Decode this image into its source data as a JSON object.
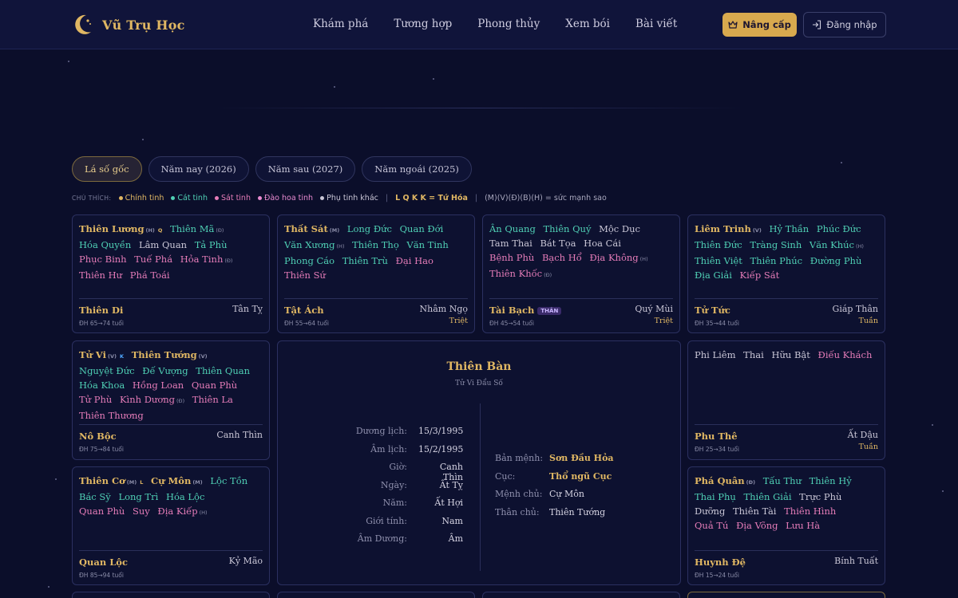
{
  "header": {
    "brand": "Vũ Trụ Học",
    "nav": [
      "Khám phá",
      "Tương hợp",
      "Phong thủy",
      "Xem bói",
      "Bài viết"
    ],
    "upgrade_label": "Nâng cấp",
    "login_label": "Đăng nhập"
  },
  "tabs": [
    "Lá số gốc",
    "Năm nay (2026)",
    "Năm sau (2027)",
    "Năm ngoái (2025)"
  ],
  "legend": {
    "label": "CHÚ THÍCH:",
    "items": [
      {
        "text": "Chính tinh",
        "color": "#e0b763"
      },
      {
        "text": "Cát tinh",
        "color": "#4fcfb4"
      },
      {
        "text": "Sát tinh",
        "color": "#e57cb8"
      },
      {
        "text": "Đào hoa tinh",
        "color": "#e88ad0"
      },
      {
        "text": "Phụ tinh khác",
        "color": "#c9c6d6"
      }
    ],
    "mutagens": "L Q K K = Tứ Hóa",
    "strength": "(M)(V)(Đ)(B)(H) = sức mạnh sao"
  },
  "center": {
    "title": "Thiên Bàn",
    "subtitle": "Tử Vi Đẩu Số",
    "left": [
      {
        "k": "Dương lịch:",
        "v": "15/3/1995"
      },
      {
        "k": "Âm lịch:",
        "v": "15/2/1995"
      },
      {
        "k": "Giờ:",
        "v": "Canh Thìn"
      },
      {
        "k": "Ngày:",
        "v": "Ất Tỵ"
      },
      {
        "k": "Năm:",
        "v": "Ất Hợi"
      },
      {
        "k": "Giới tính:",
        "v": "Nam"
      },
      {
        "k": "Âm Dương:",
        "v": "Âm"
      }
    ],
    "right": [
      {
        "k": "Bản mệnh:",
        "v": "Sơn Đầu Hỏa"
      },
      {
        "k": "Cục:",
        "v": "Thổ ngũ Cục"
      },
      {
        "k": "Mệnh chủ:",
        "v": "Cự Môn"
      },
      {
        "k": "Thân chủ:",
        "v": "Thiên Tướng"
      }
    ]
  },
  "palaces": [
    {
      "name": "Thiên Di",
      "can_chi": "Tân Tỵ",
      "age": "ĐH 65→74 tuổi",
      "tri": "",
      "stars": [
        {
          "n": "Thiên Lương",
          "t": "main",
          "b": "(H)",
          "m": "Q"
        },
        {
          "n": "Thiên Mã",
          "t": "good",
          "b": "(Đ)"
        },
        {
          "n": "Hóa Quyền",
          "t": "good"
        },
        {
          "n": "Lâm Quan",
          "t": "other"
        },
        {
          "n": "Tả Phù",
          "t": "good"
        },
        {
          "n": "Phục Binh",
          "t": "bad"
        },
        {
          "n": "Tuế Phá",
          "t": "bad"
        },
        {
          "n": "Hỏa Tinh",
          "t": "bad",
          "b": "(Đ)"
        },
        {
          "n": "Thiên Hư",
          "t": "bad"
        },
        {
          "n": "Phá Toái",
          "t": "bad"
        }
      ]
    },
    {
      "name": "Tật Ách",
      "can_chi": "Nhâm Ngọ",
      "age": "ĐH 55→64 tuổi",
      "tri": "Triệt",
      "stars": [
        {
          "n": "Thất Sát",
          "t": "main",
          "b": "(M)"
        },
        {
          "n": "Long Đức",
          "t": "good"
        },
        {
          "n": "Quan Đới",
          "t": "good"
        },
        {
          "n": "Văn Xương",
          "t": "good",
          "b": "(H)"
        },
        {
          "n": "Thiên Thọ",
          "t": "good"
        },
        {
          "n": "Văn Tinh",
          "t": "good"
        },
        {
          "n": "Phong Cáo",
          "t": "good"
        },
        {
          "n": "Thiên Trù",
          "t": "good"
        },
        {
          "n": "Đại Hao",
          "t": "bad"
        },
        {
          "n": "Thiên Sứ",
          "t": "bad"
        }
      ]
    },
    {
      "name": "Tài Bạch",
      "can_chi": "Quý Mùi",
      "age": "ĐH 45→54 tuổi",
      "tri": "Triệt",
      "than": "THÂN",
      "stars": [
        {
          "n": "Ân Quang",
          "t": "good"
        },
        {
          "n": "Thiên Quý",
          "t": "good"
        },
        {
          "n": "Mộc Dục",
          "t": "other"
        },
        {
          "n": "Tam Thai",
          "t": "other"
        },
        {
          "n": "Bát Tọa",
          "t": "other"
        },
        {
          "n": "Hoa Cái",
          "t": "other"
        },
        {
          "n": "Bệnh Phù",
          "t": "bad"
        },
        {
          "n": "Bạch Hổ",
          "t": "bad"
        },
        {
          "n": "Địa Không",
          "t": "bad",
          "b": "(H)"
        },
        {
          "n": "Thiên Khốc",
          "t": "bad",
          "b": "(Đ)"
        }
      ]
    },
    {
      "name": "Tử Tức",
      "can_chi": "Giáp Thân",
      "age": "ĐH 35→44 tuổi",
      "tri": "Tuần",
      "stars": [
        {
          "n": "Liêm Trinh",
          "t": "main",
          "b": "(V)"
        },
        {
          "n": "Hỷ Thần",
          "t": "good"
        },
        {
          "n": "Phúc Đức",
          "t": "good"
        },
        {
          "n": "Thiên Đức",
          "t": "good"
        },
        {
          "n": "Tràng Sinh",
          "t": "good"
        },
        {
          "n": "Văn Khúc",
          "t": "good",
          "b": "(H)"
        },
        {
          "n": "Thiên Việt",
          "t": "good"
        },
        {
          "n": "Thiên Phúc",
          "t": "good"
        },
        {
          "n": "Đường Phù",
          "t": "good"
        },
        {
          "n": "Địa Giải",
          "t": "good"
        },
        {
          "n": "Kiếp Sát",
          "t": "bad"
        }
      ]
    },
    {
      "name": "Nô Bộc",
      "can_chi": "Canh Thìn",
      "age": "ĐH 75→84 tuổi",
      "tri": "",
      "stars": [
        {
          "n": "Tử Vi",
          "t": "main",
          "b": "(V)",
          "m": "K"
        },
        {
          "n": "Thiên Tướng",
          "t": "main",
          "b": "(V)"
        },
        {
          "n": "Nguyệt Đức",
          "t": "good"
        },
        {
          "n": "Đế Vượng",
          "t": "good"
        },
        {
          "n": "Thiên Quan",
          "t": "good"
        },
        {
          "n": "Hóa Khoa",
          "t": "good"
        },
        {
          "n": "Hồng Loan",
          "t": "bad"
        },
        {
          "n": "Quan Phù",
          "t": "bad"
        },
        {
          "n": "Tử Phù",
          "t": "bad"
        },
        {
          "n": "Kình Dương",
          "t": "bad",
          "b": "(Đ)"
        },
        {
          "n": "Thiên La",
          "t": "bad"
        },
        {
          "n": "Thiên Thương",
          "t": "bad"
        }
      ]
    },
    {
      "name": "Phu Thê",
      "can_chi": "Ất Dậu",
      "age": "ĐH 25→34 tuổi",
      "tri": "Tuần",
      "stars": [
        {
          "n": "Phi Liêm",
          "t": "other"
        },
        {
          "n": "Thai",
          "t": "other"
        },
        {
          "n": "Hữu Bật",
          "t": "other"
        },
        {
          "n": "Điếu Khách",
          "t": "bad"
        }
      ]
    },
    {
      "name": "Quan Lộc",
      "can_chi": "Kỷ Mão",
      "age": "ĐH 85→94 tuổi",
      "tri": "",
      "stars": [
        {
          "n": "Thiên Cơ",
          "t": "main",
          "b": "(M)",
          "m": "L"
        },
        {
          "n": "Cự Môn",
          "t": "main",
          "b": "(M)"
        },
        {
          "n": "Lộc Tồn",
          "t": "good"
        },
        {
          "n": "Bác Sỹ",
          "t": "good"
        },
        {
          "n": "Long Trì",
          "t": "good"
        },
        {
          "n": "Hóa Lộc",
          "t": "good"
        },
        {
          "n": "Quan Phù",
          "t": "bad"
        },
        {
          "n": "Suy",
          "t": "bad"
        },
        {
          "n": "Địa Kiếp",
          "t": "bad",
          "b": "(H)"
        }
      ]
    },
    {
      "name": "Huynh Đệ",
      "can_chi": "Bính Tuất",
      "age": "ĐH 15→24 tuổi",
      "tri": "",
      "stars": [
        {
          "n": "Phá Quân",
          "t": "main",
          "b": "(Đ)"
        },
        {
          "n": "Tấu Thư",
          "t": "good"
        },
        {
          "n": "Thiên Hỷ",
          "t": "good"
        },
        {
          "n": "Thai Phụ",
          "t": "good"
        },
        {
          "n": "Thiên Giải",
          "t": "good"
        },
        {
          "n": "Trực Phù",
          "t": "other"
        },
        {
          "n": "Dưỡng",
          "t": "other"
        },
        {
          "n": "Thiên Tài",
          "t": "other"
        },
        {
          "n": "Thiên Hình",
          "t": "bad"
        },
        {
          "n": "Quả Tú",
          "t": "bad"
        },
        {
          "n": "Địa Võng",
          "t": "bad"
        },
        {
          "n": "Lưu Hà",
          "t": "bad"
        }
      ]
    }
  ]
}
